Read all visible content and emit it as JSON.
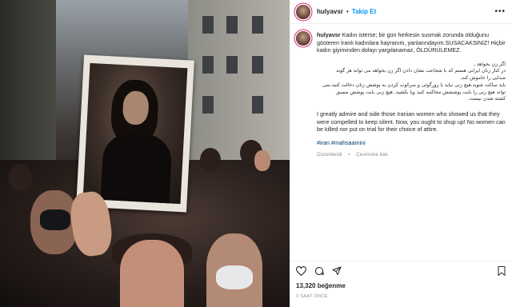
{
  "post": {
    "username": "hulyavsr",
    "follow_label": "Takip Et",
    "separator": "•",
    "more_label": "•••",
    "caption_tr": "Kadın isterse; bir gün herkesin susmak zorunda olduğunu gösteren İranlı kadınlara hayranım, yanlarındayım.SUSACAKSINIZ! Hiçbir kadın giyiminden dolayı yargılanamaz, ÖLDÜRÜLEMEZ.",
    "caption_fa": [
      "اگر زن بخواهد ,",
      "در کنار زنان ایرانی هستم که با شجاعت نشان دادن اگر زن بخواهد می تواند هر گونه",
      "صدایی را خاموش کند,",
      "باید ساکت شوید.هیچ زنی نباید با زورگوئی و سرکوب کردن به پوشش زنان دخالت کنید.نمی",
      "تواند هیچ زنی را بابت پوششش محاکمه کنید ویا بکشید. هیچ زنی بابت پوشش مسبق",
      "کشته شدن نیست."
    ],
    "caption_en": "I greatly admire and side those Iranian women who showed us that they were compelled to keep silent. Now, you ought to shup up! No women can be killed nor put on trial for their choice of attire.",
    "hashtags": "#iran #mahsaamini",
    "edited_label": "Düzenlendi",
    "translate_label": "Çevirisine bak",
    "likes": "13,320 beğenme",
    "time_ago": "3 SAAT ÖNCE"
  },
  "icons": {
    "like": "heart-icon",
    "comment": "comment-icon",
    "share": "share-icon",
    "save": "bookmark-icon"
  },
  "colors": {
    "follow_blue": "#0095f6",
    "hashtag_blue": "#00376b",
    "muted_gray": "#8e8e8e"
  }
}
